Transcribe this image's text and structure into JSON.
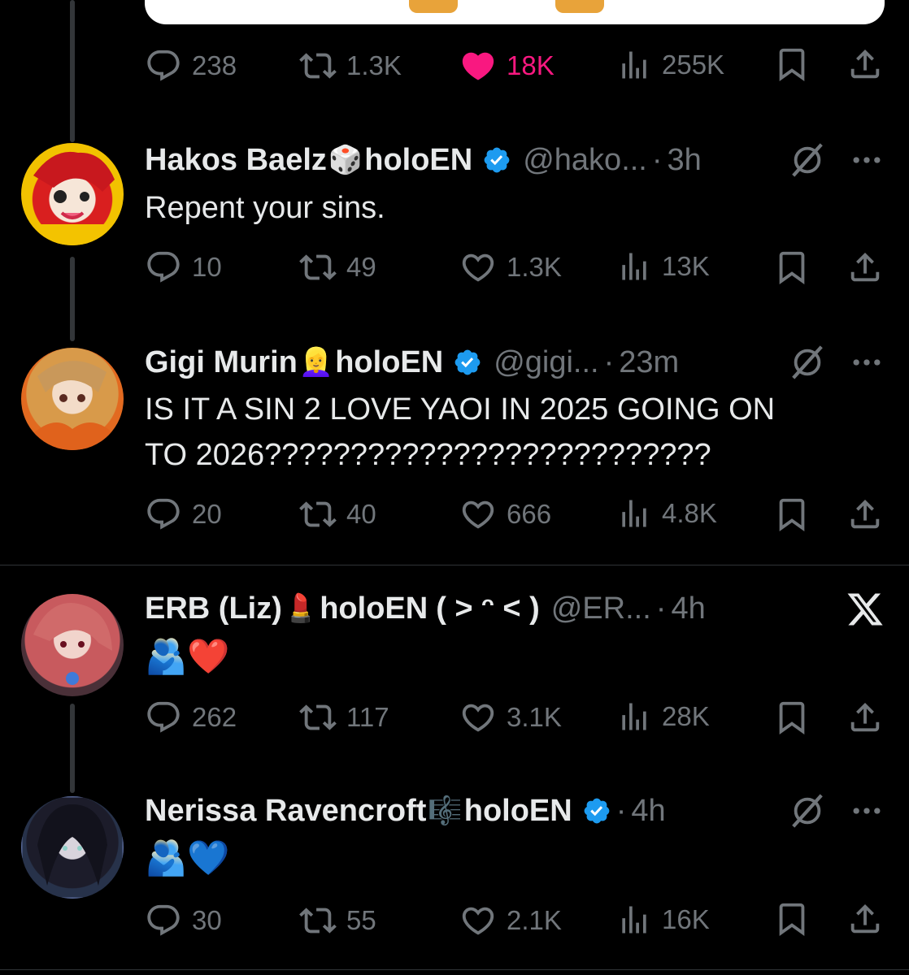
{
  "colors": {
    "background": "#000000",
    "text": "#e7e9ea",
    "muted": "#71767b",
    "like_active": "#f91880",
    "verified": "#1d9bf0"
  },
  "top_tweet": {
    "actions": {
      "replies": "238",
      "reposts": "1.3K",
      "likes": "18K",
      "views": "255K",
      "liked": true
    }
  },
  "tweets": [
    {
      "name": "Hakos Baelz",
      "name_emoji": "🎲",
      "affiliation": "holoEN",
      "verified": true,
      "handle": "@hako...",
      "dot": "·",
      "time": "3h",
      "right_icon": "grok-icon",
      "text": "Repent your sins.",
      "actions": {
        "replies": "10",
        "reposts": "49",
        "likes": "1.3K",
        "views": "13K"
      }
    },
    {
      "name": "Gigi Murin",
      "name_emoji": "👱‍♀️",
      "affiliation": "holoEN",
      "verified": true,
      "handle": "@gigi...",
      "dot": "·",
      "time": "23m",
      "right_icon": "grok-icon",
      "text_line1": "IS IT A SIN 2 LOVE YAOI IN 2025 GOING ON",
      "text_line2": "TO 2026??????????????????????????",
      "actions": {
        "replies": "20",
        "reposts": "40",
        "likes": "666",
        "views": "4.8K"
      }
    },
    {
      "name": "ERB (Liz)",
      "name_emoji": "💄",
      "affiliation": "holoEN",
      "kaomoji": "( ˃ ᵔ ˂ )",
      "handle": "@ER...",
      "dot": "·",
      "time": "4h",
      "right_icon": "x-logo-icon",
      "text": "🫂❤️",
      "actions": {
        "replies": "262",
        "reposts": "117",
        "likes": "3.1K",
        "views": "28K"
      }
    },
    {
      "name": "Nerissa Ravencroft",
      "name_emoji": "🎼",
      "affiliation": "holoEN",
      "verified": true,
      "dot": "·",
      "time": "4h",
      "right_icon": "grok-icon",
      "text": "🫂💙",
      "actions": {
        "replies": "30",
        "reposts": "55",
        "likes": "2.1K",
        "views": "16K"
      }
    }
  ]
}
